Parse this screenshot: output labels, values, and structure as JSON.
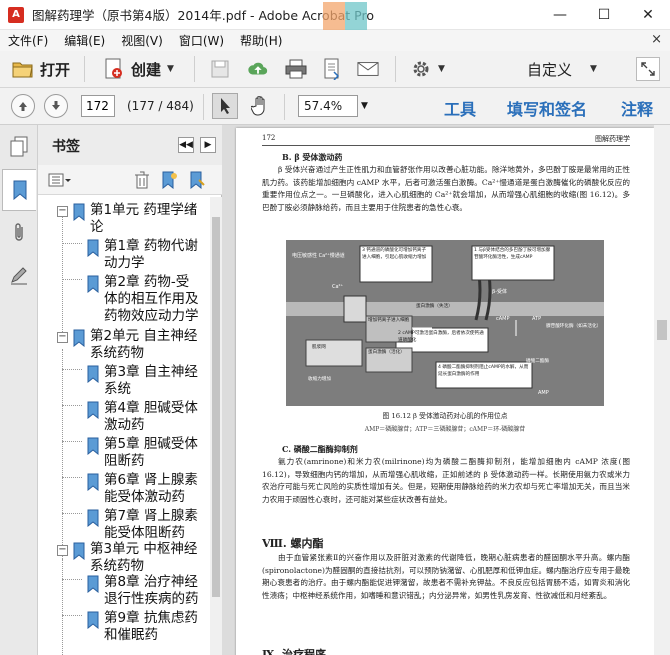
{
  "window": {
    "title": "图解药理学（原书第4版）2014年.pdf - Adobe Acrobat Pro",
    "controls": {
      "minimize": "—",
      "maximize": "☐",
      "close": "✕"
    }
  },
  "menu": {
    "items": [
      "文件(F)",
      "编辑(E)",
      "视图(V)",
      "窗口(W)",
      "帮助(H)"
    ],
    "close_glyph": "×"
  },
  "toolbar": {
    "open_label": "打开",
    "create_label": "创建",
    "customize_label": "自定义"
  },
  "navigation": {
    "current_page": "172",
    "page_count": "(177 / 484)",
    "zoom": "57.4%",
    "tools_label": "工具",
    "fill_sign_label": "填写和签名",
    "comment_label": "注释"
  },
  "bookmarks": {
    "title": "书签",
    "items": [
      {
        "level": 0,
        "lines": [
          "第1单元 药理学绪",
          "论"
        ]
      },
      {
        "level": 1,
        "lines": [
          "第1章 药物代谢",
          "动力学"
        ]
      },
      {
        "level": 1,
        "lines": [
          "第2章 药物-受",
          "体的相互作用及",
          "药物效应动力学"
        ]
      },
      {
        "level": 0,
        "lines": [
          "第2单元 自主神经",
          "系统药物"
        ]
      },
      {
        "level": 1,
        "lines": [
          "第3章 自主神经",
          "系统"
        ]
      },
      {
        "level": 1,
        "lines": [
          "第4章 胆碱受体",
          "激动药"
        ]
      },
      {
        "level": 1,
        "lines": [
          "第5章 胆碱受体",
          "阻断药"
        ]
      },
      {
        "level": 1,
        "lines": [
          "第6章 肾上腺素",
          "能受体激动药"
        ]
      },
      {
        "level": 1,
        "lines": [
          "第7章 肾上腺素",
          "能受体阻断药"
        ]
      },
      {
        "level": 0,
        "lines": [
          "第3单元 中枢神经",
          "系统药物"
        ]
      },
      {
        "level": 1,
        "lines": [
          "第8章 治疗神经",
          "退行性疾病的药"
        ]
      },
      {
        "level": 1,
        "lines": [
          "第9章 抗焦虑药",
          "和催眠药"
        ]
      }
    ]
  },
  "page": {
    "number": "172",
    "book_title": "图解药理学",
    "section_b_title": "B. β 受体激动药",
    "section_b_text": "β 受体兴奋通过产生正性肌力和血管舒张作用以改善心脏功能。除洋地黄外，多巴酚丁胺是最常用的正性肌力药。该药能增加细胞内 cAMP 水平，后者可激活蛋白激酶。Ca²⁺慢通道是蛋白激酶催化的磷酸化反应的重要作用位点之一。一旦磷酸化，进入心肌细胞的 Ca²⁺就会增加，从而增强心肌细胞的收缩(图 16.12)。多巴酚丁胺必须静脉给药，而且主要用于住院患者的急性心衰。",
    "figure": {
      "label_ca_channel": "电压敏感性 Ca²⁺慢通道",
      "label_ca": "Ca²⁺",
      "label_beta_receptor": "β-受体",
      "callout_1": "1 与β受体结合的多巴酚丁胺可增加腺苷酸环化酶活性，生成cAMP",
      "callout_2": "2 cAMP可激活蛋白激酶，后者依次使钙通道磷酸化",
      "callout_3": "3 钙通道的磷酸化可增加钙离子进入细胞，引起心肌收缩力增加",
      "callout_4": "4 磷酸二酯酶抑制剂阻止cAMP的水解，从而延长蛋白激酶的作用",
      "label_increase_ca": "增加钙离子进入细胞",
      "label_pka_active": "蛋白激酶（活化）",
      "label_pka_inactive": "蛋白激酶（失活）",
      "label_pde": "磷酸二酯酶",
      "label_camp": "cAMP",
      "label_atp": "ATP",
      "label_ac": "腺苷酸环化酶（如未活化）",
      "label_sr": "肌浆网",
      "label_contraction": "收缩力增加",
      "label_amp": "AMP"
    },
    "figure_caption": "图 16.12  β 受体激动药对心肌的作用位点",
    "figure_abbrev": "AMP＝磷酸腺苷；ATP＝三磷酸腺苷；cAMP＝环-磷酸腺苷",
    "section_c_title": "C. 磷酸二酯酶抑制剂",
    "section_c_text": "氨力农(amrinone)和米力农(milrinone)均为磷酸二酯酶抑制剂，能增加细胞内 cAMP 浓度(图 16.12)，导致细胞内钙的增加，从而增强心肌收缩，正如前述的 β 受体激动药一样。长期使用氨力农或米力农治疗可能与死亡风险的实质性增加有关。但是，短期使用静脉给药的米力农却与死亡率增加无关，而且当米力农用于顽固性心衰时，还可能对某些症状改善有益处。",
    "section_8_title": "Ⅷ. 螺内酯",
    "section_8_text": "由于血管紧张素Ⅱ的兴奋作用以及肝脏对激素的代谢降低，晚期心脏病患者的醛固酮水平升高。螺内酯(spironolactone)为醛固酮的直接拮抗剂，可以预防钠潴留、心肌肥厚和低钾血症。螺内酯治疗应专用于最晚期心衰患者的治疗。由于螺内酯能促进钾潴留，故患者不需补充钾盐。不良反应包括胃肠不适，如胃炎和消化性溃疡；中枢神经系统作用，如嗜睡和意识错乱；内分泌异常，如男性乳房发育、性欲减低和月经紊乱。",
    "section_9_title": "Ⅸ. 治疗程序"
  },
  "colors": {
    "link_blue": "#2a6fba",
    "figure_gray": "#7d7d7d",
    "acrobat_red": "#d62d20"
  }
}
